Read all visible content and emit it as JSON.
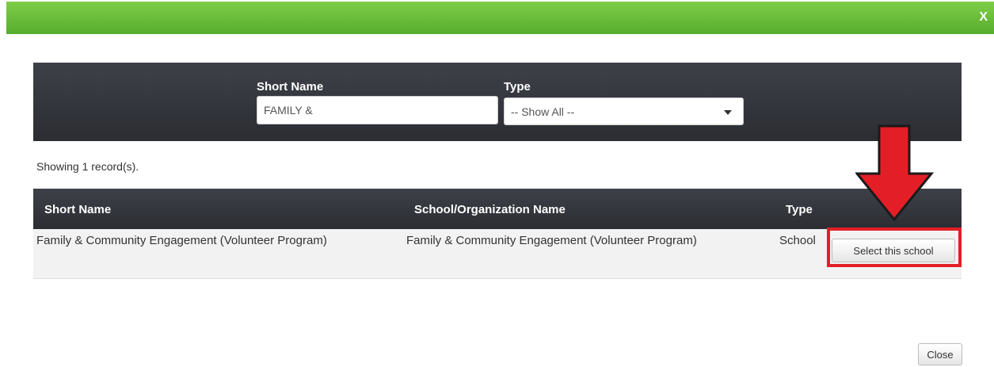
{
  "dialog": {
    "close_x": "X",
    "header_color": "#6cbf3d"
  },
  "filters": {
    "short_name_label": "Short Name",
    "short_name_value": "FAMILY &",
    "type_label": "Type",
    "type_selected": "-- Show All --"
  },
  "results": {
    "count_text": "Showing 1 record(s).",
    "columns": [
      "Short Name",
      "School/Organization Name",
      "Type"
    ],
    "rows": [
      {
        "short_name": "Family & Community Engagement (Volunteer Program)",
        "org_name": "Family & Community Engagement (Volunteer Program)",
        "type": "School",
        "action_label": "Select this school"
      }
    ]
  },
  "annotation": {
    "color": "#e41e26",
    "arrow_icon": "arrow-down-icon"
  },
  "footer": {
    "close_label": "Close"
  }
}
